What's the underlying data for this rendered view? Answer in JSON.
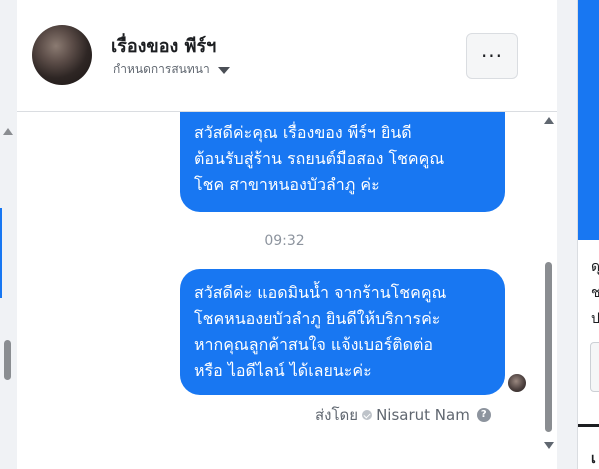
{
  "header": {
    "title": "เรื่องของ พีร์ฯ",
    "subtitle": "กำหนดการสนทนา",
    "more_label": "···"
  },
  "messages": [
    {
      "lines": [
        "สวัสดีค่ะคุณ เรื่องของ พีร์ฯ ยินดี",
        "ต้อนรับสู่ร้าน รถยนต์มือสอง โชคคูณ",
        "โชค สาขาหนองบัวลำภู ค่ะ"
      ]
    },
    {
      "lines": [
        "สวัสดีค่ะ แอดมินน้ำ จากร้านโชคคูณ",
        "โชคหนองยบัวลำภู ยินดีให้บริการค่ะ",
        "หากคุณลูกค้าสนใจ แจ้งเบอร์ติดต่อ",
        "หรือ ไอดีไลน์ ได้เลยนะค่ะ"
      ]
    }
  ],
  "timestamp": "09:32",
  "sent_by": {
    "prefix": "ส่งโดย",
    "name": "Nisarut Nam",
    "help": "?"
  },
  "right_panel": {
    "text_1": "ดุ",
    "text_2": "ช",
    "text_3": "ป",
    "text_4": "เ"
  },
  "colors": {
    "bubble": "#1877f2",
    "accent": "#1877f2"
  }
}
